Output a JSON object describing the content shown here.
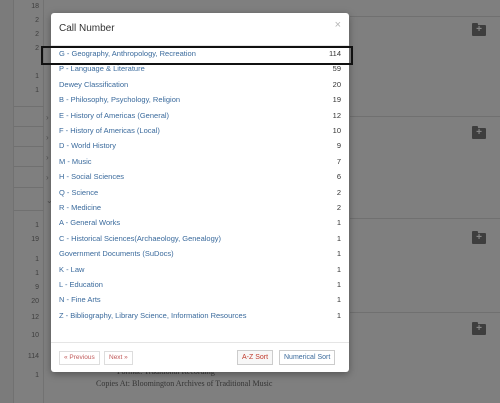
{
  "background": {
    "numbers": [
      "18",
      "2",
      "2",
      "2",
      "1",
      "1",
      "1",
      "19",
      "1",
      "1",
      "9",
      "20",
      "12",
      "10",
      "114",
      "1"
    ],
    "text_lines": [
      "Format: Traditional Recording",
      "Copies At: Bloomington Archives of Traditional Music"
    ],
    "folder_icon_label": "+"
  },
  "modal": {
    "title": "Call Number",
    "close_label": "×",
    "items": [
      {
        "label": "G - Geography, Anthropology, Recreation",
        "count": "114"
      },
      {
        "label": "P - Language & Literature",
        "count": "59"
      },
      {
        "label": "Dewey Classification",
        "count": "20"
      },
      {
        "label": "B - Philosophy, Psychology, Religion",
        "count": "19"
      },
      {
        "label": "E - History of Americas (General)",
        "count": "12"
      },
      {
        "label": "F - History of Americas (Local)",
        "count": "10"
      },
      {
        "label": "D - World History",
        "count": "9"
      },
      {
        "label": "M - Music",
        "count": "7"
      },
      {
        "label": "H - Social Sciences",
        "count": "6"
      },
      {
        "label": "Q - Science",
        "count": "2"
      },
      {
        "label": "R - Medicine",
        "count": "2"
      },
      {
        "label": "A - General Works",
        "count": "1"
      },
      {
        "label": "C - Historical Sciences(Archaeology, Genealogy)",
        "count": "1"
      },
      {
        "label": "Government Documents (SuDocs)",
        "count": "1"
      },
      {
        "label": "K - Law",
        "count": "1"
      },
      {
        "label": "L - Education",
        "count": "1"
      },
      {
        "label": "N - Fine Arts",
        "count": "1"
      },
      {
        "label": "Z - Bibliography, Library Science, Information Resources",
        "count": "1"
      }
    ],
    "footer": {
      "previous_label": "« Previous",
      "next_label": "Next »",
      "az_sort_label": "A-Z Sort",
      "numerical_sort_label": "Numerical Sort"
    }
  },
  "colors": {
    "link": "#3a6a9c",
    "pager_text": "#c15a5a",
    "az_sort_active": "#c0392b"
  }
}
